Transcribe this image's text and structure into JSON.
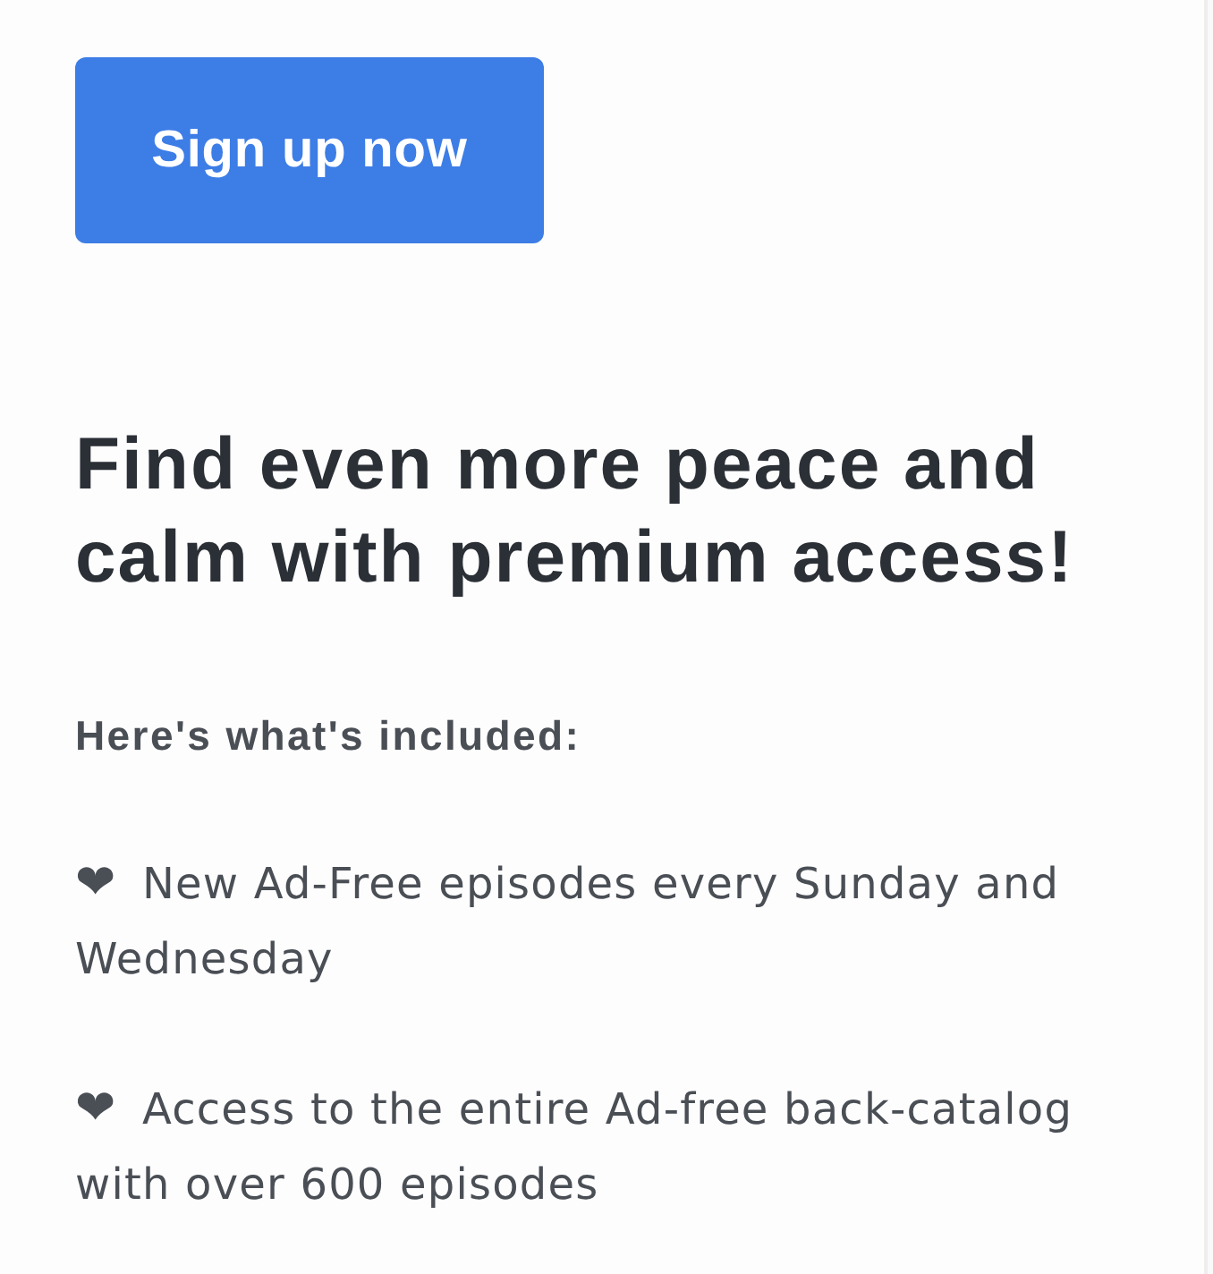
{
  "signup_button": {
    "label": "Sign up now"
  },
  "heading": "Find even more peace and calm with premium access!",
  "included_label": "Here's what's included:",
  "features": [
    {
      "bullet": "❤",
      "text": "New Ad-Free episodes every Sunday and Wednesday"
    },
    {
      "bullet": "❤",
      "text": "Access to the entire Ad-free back-catalog with over 600 episodes"
    }
  ]
}
